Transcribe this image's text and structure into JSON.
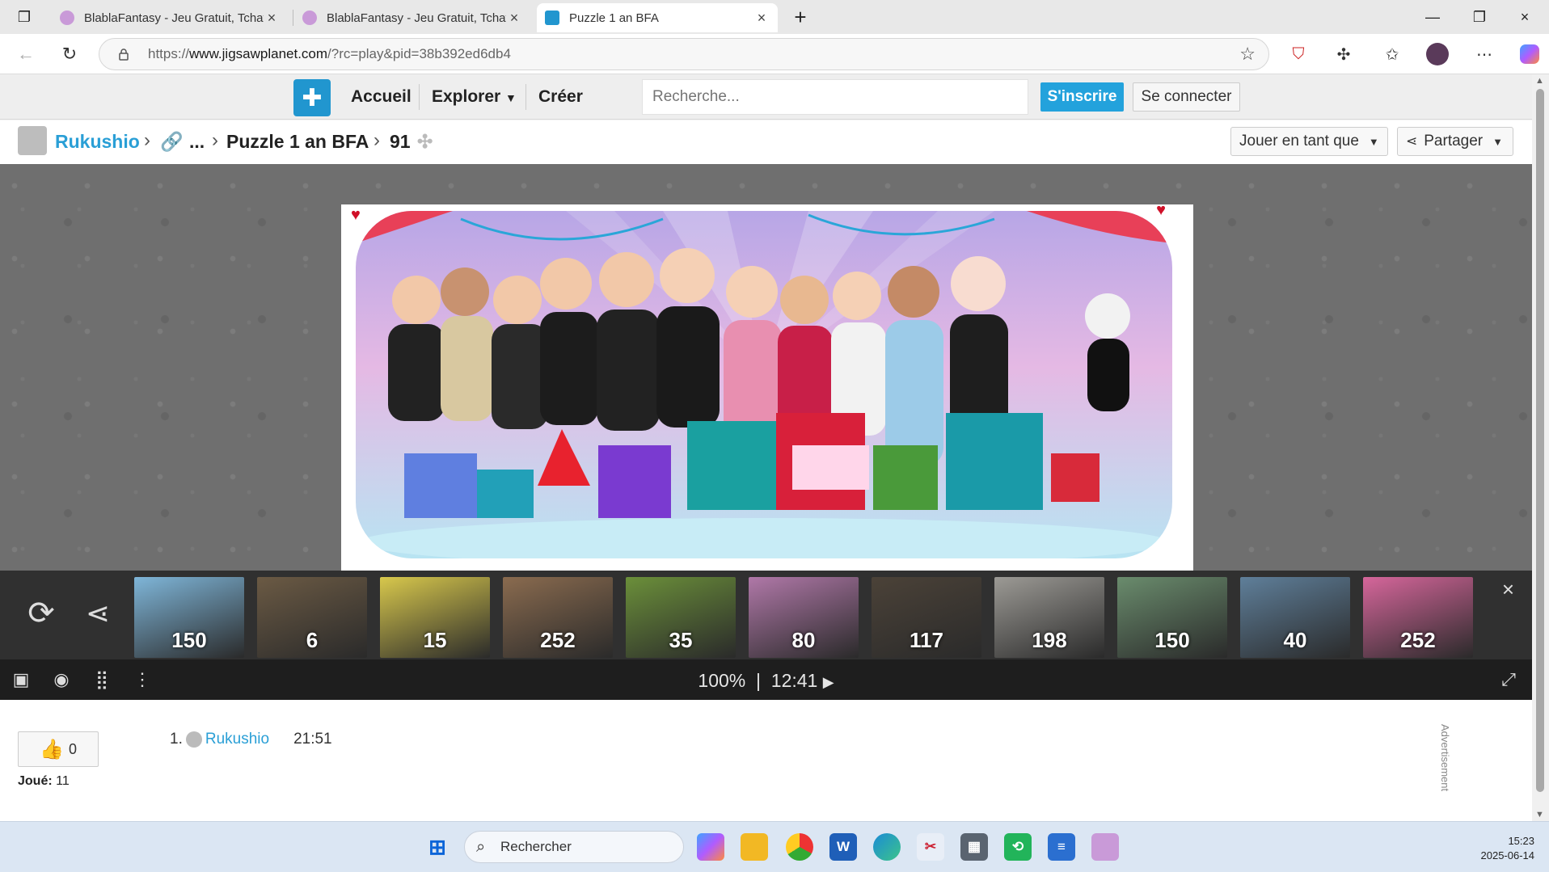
{
  "browser": {
    "tabs": [
      {
        "title": "BlablaFantasy - Jeu Gratuit, Tchat",
        "active": false
      },
      {
        "title": "BlablaFantasy - Jeu Gratuit, Tchat",
        "active": false
      },
      {
        "title": "Puzzle 1 an BFA",
        "active": true
      }
    ],
    "url_prefix": "https://",
    "url_domain": "www.jigsawplanet.com",
    "url_path": "/?rc=play&pid=38b392ed6db4",
    "new_tab": "+",
    "close_glyph": "×"
  },
  "site": {
    "nav": {
      "home": "Accueil",
      "explore": "Explorer",
      "create": "Créer"
    },
    "search_placeholder": "Recherche...",
    "signup": "S'inscrire",
    "login": "Se connecter"
  },
  "breadcrumb": {
    "user": "Rukushio",
    "ellipsis": "...",
    "puzzle_title": "Puzzle 1 an BFA",
    "pieces": "91",
    "play_as": "Jouer en tant que",
    "share": "Partager"
  },
  "thumbnails": [
    {
      "count": "150",
      "color": "#7fb6d9"
    },
    {
      "count": "6",
      "color": "#6b5a44"
    },
    {
      "count": "15",
      "color": "#d8c84c"
    },
    {
      "count": "252",
      "color": "#8a6b4f"
    },
    {
      "count": "35",
      "color": "#6b8f3a"
    },
    {
      "count": "80",
      "color": "#b078a8"
    },
    {
      "count": "117",
      "color": "#4b4238"
    },
    {
      "count": "198",
      "color": "#9c9a95"
    },
    {
      "count": "150",
      "color": "#6a8c6d"
    },
    {
      "count": "40",
      "color": "#5f7f9a"
    },
    {
      "count": "252",
      "color": "#d6669b"
    }
  ],
  "status": {
    "zoom": "100%",
    "separator": "|",
    "time": "12:41"
  },
  "stats": {
    "likes": "0",
    "played_label": "Joué:",
    "played_value": "11",
    "rank": "1.",
    "rank_user": "Rukushio",
    "rank_time": "21:51",
    "advertisement": "Advertisement"
  },
  "taskbar": {
    "search": "Rechercher",
    "time": "15:23",
    "date": "2025-06-14"
  },
  "colors": {
    "accent": "#23a2dc",
    "link": "#2a9fd6",
    "logo": "#2196cf"
  }
}
